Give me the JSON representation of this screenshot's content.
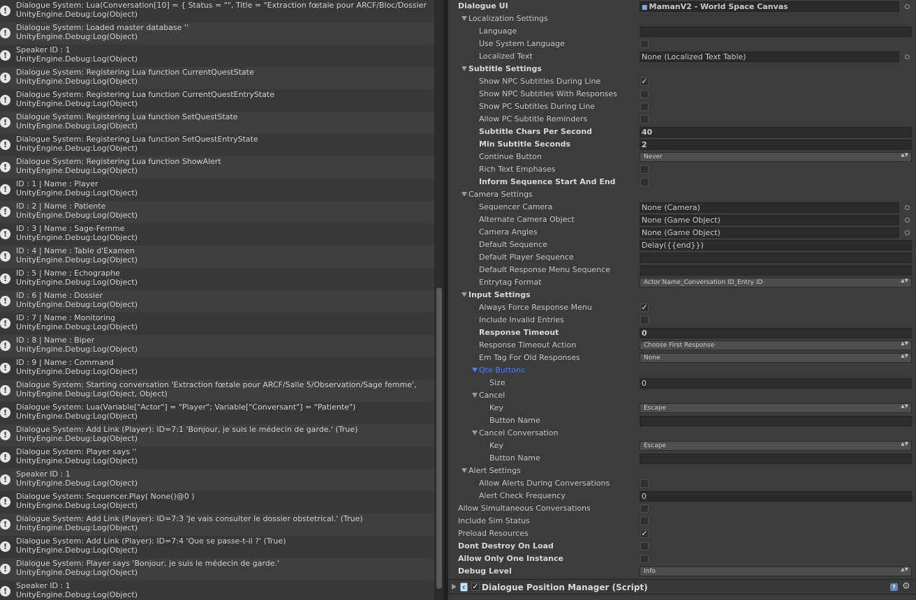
{
  "console": {
    "entries": [
      {
        "message": "Dialogue System: Lua(Conversation[10] = { Status = \"\", Title = \"Extraction fœtale pour ARCF/Bloc/Dossier",
        "trace": "UnityEngine.Debug:Log(Object)"
      },
      {
        "message": "Dialogue System: Loaded master database ''",
        "trace": "UnityEngine.Debug:Log(Object)"
      },
      {
        "message": "Speaker ID : 1",
        "trace": "UnityEngine.Debug:Log(Object)"
      },
      {
        "message": "Dialogue System: Registering Lua function CurrentQuestState",
        "trace": "UnityEngine.Debug:Log(Object)"
      },
      {
        "message": "Dialogue System: Registering Lua function CurrentQuestEntryState",
        "trace": "UnityEngine.Debug:Log(Object)"
      },
      {
        "message": "Dialogue System: Registering Lua function SetQuestState",
        "trace": "UnityEngine.Debug:Log(Object)"
      },
      {
        "message": "Dialogue System: Registering Lua function SetQuestEntryState",
        "trace": "UnityEngine.Debug:Log(Object)"
      },
      {
        "message": "Dialogue System: Registering Lua function ShowAlert",
        "trace": "UnityEngine.Debug:Log(Object)"
      },
      {
        "message": "ID : 1 | Name : Player",
        "trace": "UnityEngine.Debug:Log(Object)"
      },
      {
        "message": "ID : 2 | Name : Patiente",
        "trace": "UnityEngine.Debug:Log(Object)"
      },
      {
        "message": "ID : 3 | Name : Sage-Femme",
        "trace": "UnityEngine.Debug:Log(Object)"
      },
      {
        "message": "ID : 4 | Name : Table d'Examen",
        "trace": "UnityEngine.Debug:Log(Object)"
      },
      {
        "message": "ID : 5 | Name : Echographe",
        "trace": "UnityEngine.Debug:Log(Object)"
      },
      {
        "message": "ID : 6 | Name : Dossier",
        "trace": "UnityEngine.Debug:Log(Object)"
      },
      {
        "message": "ID : 7 | Name : Monitoring",
        "trace": "UnityEngine.Debug:Log(Object)"
      },
      {
        "message": "ID : 8 | Name : Biper",
        "trace": "UnityEngine.Debug:Log(Object)"
      },
      {
        "message": "ID : 9 | Name : Command",
        "trace": "UnityEngine.Debug:Log(Object)"
      },
      {
        "message": "Dialogue System: Starting conversation 'Extraction fœtale pour ARCF/Salle 5/Observation/Sage femme',",
        "trace": "UnityEngine.Debug:Log(Object, Object)"
      },
      {
        "message": "Dialogue System: Lua(Variable[\"Actor\"] = \"Player\"; Variable[\"Conversant\"] = \"Patiente\")",
        "trace": "UnityEngine.Debug:Log(Object)"
      },
      {
        "message": "Dialogue System: Add Link (Player): ID=7:1 'Bonjour, je suis le médecin de garde.' (True)",
        "trace": "UnityEngine.Debug:Log(Object)"
      },
      {
        "message": "Dialogue System: Player says ''",
        "trace": "UnityEngine.Debug:Log(Object)"
      },
      {
        "message": "Speaker ID : 1",
        "trace": "UnityEngine.Debug:Log(Object)"
      },
      {
        "message": "Dialogue System: Sequencer.Play( None()@0 )",
        "trace": "UnityEngine.Debug:Log(Object)"
      },
      {
        "message": "Dialogue System: Add Link (Player): ID=7:3 'Je vais consulter le dossier obstetrical.' (True)",
        "trace": "UnityEngine.Debug:Log(Object)"
      },
      {
        "message": "Dialogue System: Add Link (Player): ID=7:4 'Que se passe-t-il ?' (True)",
        "trace": "UnityEngine.Debug:Log(Object)"
      },
      {
        "message": "Dialogue System: Player says 'Bonjour, je suis le médecin de garde.'",
        "trace": "UnityEngine.Debug:Log(Object)"
      },
      {
        "message": "Speaker ID : 1",
        "trace": "UnityEngine.Debug:Log(Object)"
      }
    ]
  },
  "inspector": {
    "rows": [
      {
        "label": "Dialogue UI",
        "indent": 0,
        "bold": true,
        "control": "object",
        "value": "MamanV2 - World Space Canvas",
        "value_bold": true,
        "go_icon": true
      },
      {
        "label": "Localization Settings",
        "indent": 1,
        "foldout": true,
        "control": "none"
      },
      {
        "label": "Language",
        "indent": 2,
        "control": "text",
        "value": ""
      },
      {
        "label": "Use System Language",
        "indent": 2,
        "control": "checkbox",
        "checked": false
      },
      {
        "label": "Localized Text",
        "indent": 2,
        "control": "object",
        "value": "None (Localized Text Table)"
      },
      {
        "label": "Subtitle Settings",
        "indent": 1,
        "foldout": true,
        "bold": true,
        "control": "none"
      },
      {
        "label": "Show NPC Subtitles During Line",
        "indent": 2,
        "control": "checkbox",
        "checked": true
      },
      {
        "label": "Show NPC Subtitles With Responses",
        "indent": 2,
        "control": "checkbox",
        "checked": false
      },
      {
        "label": "Show PC Subtitles During Line",
        "indent": 2,
        "control": "checkbox",
        "checked": false
      },
      {
        "label": "Allow PC Subtitle Reminders",
        "indent": 2,
        "control": "checkbox",
        "checked": false
      },
      {
        "label": "Subtitle Chars Per Second",
        "indent": 2,
        "bold": true,
        "control": "text",
        "value": "40",
        "value_bold": true
      },
      {
        "label": "Min Subtitle Seconds",
        "indent": 2,
        "bold": true,
        "control": "text",
        "value": "2",
        "value_bold": true
      },
      {
        "label": "Continue Button",
        "indent": 2,
        "control": "dropdown",
        "value": "Never"
      },
      {
        "label": "Rich Text Emphases",
        "indent": 2,
        "control": "checkbox",
        "checked": false
      },
      {
        "label": "Inform Sequence Start And End",
        "indent": 2,
        "bold": true,
        "control": "checkbox",
        "checked": false
      },
      {
        "label": "Camera Settings",
        "indent": 1,
        "foldout": true,
        "control": "none"
      },
      {
        "label": "Sequencer Camera",
        "indent": 2,
        "control": "object",
        "value": "None (Camera)"
      },
      {
        "label": "Alternate Camera Object",
        "indent": 2,
        "control": "object",
        "value": "None (Game Object)"
      },
      {
        "label": "Camera Angles",
        "indent": 2,
        "control": "object",
        "value": "None (Game Object)"
      },
      {
        "label": "Default Sequence",
        "indent": 2,
        "control": "text",
        "value": "Delay({{end}})"
      },
      {
        "label": "Default Player Sequence",
        "indent": 2,
        "control": "text",
        "value": ""
      },
      {
        "label": "Default Response Menu Sequence",
        "indent": 2,
        "control": "text",
        "value": ""
      },
      {
        "label": "Entrytag Format",
        "indent": 2,
        "control": "dropdown",
        "value": "Actor Name_Conversation ID_Entry ID"
      },
      {
        "label": "Input Settings",
        "indent": 1,
        "foldout": true,
        "bold": true,
        "control": "none"
      },
      {
        "label": "Always Force Response Menu",
        "indent": 2,
        "control": "checkbox",
        "checked": true
      },
      {
        "label": "Include Invalid Entries",
        "indent": 2,
        "control": "checkbox",
        "checked": false
      },
      {
        "label": "Response Timeout",
        "indent": 2,
        "bold": true,
        "control": "text",
        "value": "0",
        "value_bold": true
      },
      {
        "label": "Response Timeout Action",
        "indent": 2,
        "control": "dropdown",
        "value": "Choose First Response"
      },
      {
        "label": "Em Tag For Old Responses",
        "indent": 2,
        "control": "dropdown",
        "value": "None"
      },
      {
        "label": "Qte Buttons",
        "indent": 2,
        "foldout": true,
        "blue": true,
        "control": "none"
      },
      {
        "label": "Size",
        "indent": 3,
        "control": "text",
        "value": "0"
      },
      {
        "label": "Cancel",
        "indent": 2,
        "foldout": true,
        "control": "none"
      },
      {
        "label": "Key",
        "indent": 3,
        "control": "dropdown",
        "value": "Escape"
      },
      {
        "label": "Button Name",
        "indent": 3,
        "control": "text",
        "value": ""
      },
      {
        "label": "Cancel Conversation",
        "indent": 2,
        "foldout": true,
        "control": "none"
      },
      {
        "label": "Key",
        "indent": 3,
        "control": "dropdown",
        "value": "Escape"
      },
      {
        "label": "Button Name",
        "indent": 3,
        "control": "text",
        "value": ""
      },
      {
        "label": "Alert Settings",
        "indent": 1,
        "foldout": true,
        "control": "none"
      },
      {
        "label": "Allow Alerts During Conversations",
        "indent": 2,
        "control": "checkbox",
        "checked": false
      },
      {
        "label": "Alert Check Frequency",
        "indent": 2,
        "control": "text",
        "value": "0"
      },
      {
        "label": "Allow Simultaneous Conversations",
        "indent": 0,
        "control": "checkbox",
        "checked": false
      },
      {
        "label": "Include Sim Status",
        "indent": 0,
        "control": "checkbox",
        "checked": false
      },
      {
        "label": "Preload Resources",
        "indent": 0,
        "control": "checkbox",
        "checked": true
      },
      {
        "label": "Dont Destroy On Load",
        "indent": 0,
        "bold": true,
        "control": "checkbox",
        "checked": false
      },
      {
        "label": "Allow Only One Instance",
        "indent": 0,
        "bold": true,
        "control": "checkbox",
        "checked": false
      },
      {
        "label": "Debug Level",
        "indent": 0,
        "bold": true,
        "control": "dropdown",
        "value": "Info"
      }
    ],
    "component": {
      "title": "Dialogue Position Manager (Script)",
      "enabled": true
    }
  },
  "glyphs": {
    "info": "!",
    "check": "✓",
    "dropdown_arrows": "▲▼",
    "help": "?",
    "gear": "⚙",
    "script": "c",
    "go_icon": "■"
  },
  "colors": {
    "accent_blue": "#4c7eff"
  }
}
